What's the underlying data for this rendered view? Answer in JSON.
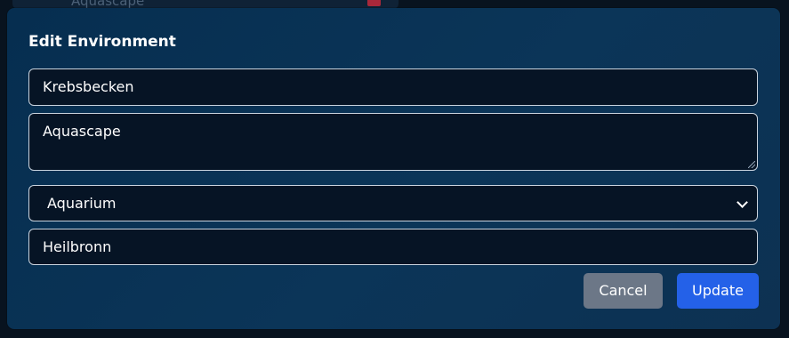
{
  "background": {
    "row_text": "Aquascape"
  },
  "modal": {
    "title": "Edit Environment",
    "name_value": "Krebsbecken",
    "description_value": "Aquascape",
    "type_selected": "Aquarium",
    "location_value": "Heilbronn",
    "cancel_label": "Cancel",
    "update_label": "Update"
  },
  "colors": {
    "modal_bg": "#0b3558",
    "field_bg": "#061425",
    "field_border": "#c9d3de",
    "cancel_bg": "#6c7787",
    "update_bg": "#2461e8",
    "delete_accent": "#a8283a"
  },
  "icons": {
    "background_delete": "trash-icon",
    "select_arrow": "chevron-down-icon",
    "textarea_resize": "resize-grip-icon"
  }
}
